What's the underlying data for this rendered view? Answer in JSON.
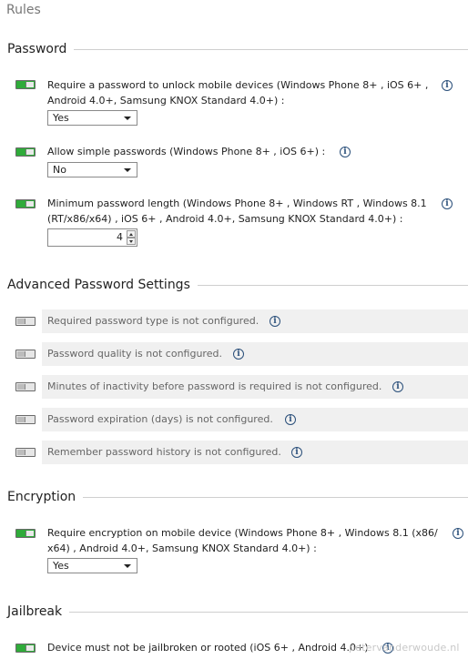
{
  "title": "Rules",
  "sections": {
    "password": {
      "heading": "Password",
      "rules": [
        {
          "text": "Require a password to unlock mobile devices (Windows Phone 8+ , iOS 6+ , Android 4.0+, Samsung KNOX Standard 4.0+) :",
          "enabled": true,
          "select_value": "Yes"
        },
        {
          "text": "Allow simple passwords (Windows Phone 8+ , iOS 6+) :",
          "enabled": true,
          "select_value": "No"
        },
        {
          "text": "Minimum password length (Windows Phone 8+ , Windows RT , Windows 8.1 (RT/x86/x64) , iOS 6+ , Android 4.0+, Samsung KNOX Standard 4.0+) :",
          "enabled": true,
          "stepper_value": "4"
        }
      ]
    },
    "advanced": {
      "heading": "Advanced Password Settings",
      "rules": [
        {
          "text": "Required password type is not configured.",
          "enabled": false
        },
        {
          "text": "Password quality is not configured.",
          "enabled": false
        },
        {
          "text": "Minutes of inactivity before password is required is not configured.",
          "enabled": false
        },
        {
          "text": "Password expiration (days) is not configured.",
          "enabled": false
        },
        {
          "text": "Remember password history is not configured.",
          "enabled": false
        }
      ]
    },
    "encryption": {
      "heading": "Encryption",
      "rules": [
        {
          "text": "Require encryption on mobile device (Windows Phone 8+ , Windows 8.1 (x86/ x64) , Android 4.0+, Samsung KNOX Standard 4.0+) :",
          "enabled": true,
          "select_value": "Yes"
        }
      ]
    },
    "jailbreak": {
      "heading": "Jailbreak",
      "rules": [
        {
          "text": "Device must not be jailbroken or rooted (iOS 6+ , Android 4.0+)",
          "enabled": true
        }
      ]
    }
  },
  "info_icon_glyph": "i",
  "watermark": "petervanderwoude.nl",
  "colors": {
    "toggle_on": "#2fab3a",
    "toggle_off": "#e6e6e6",
    "info_icon": "#2a4f7a",
    "disabled_row_bg": "#f0f0f0"
  }
}
